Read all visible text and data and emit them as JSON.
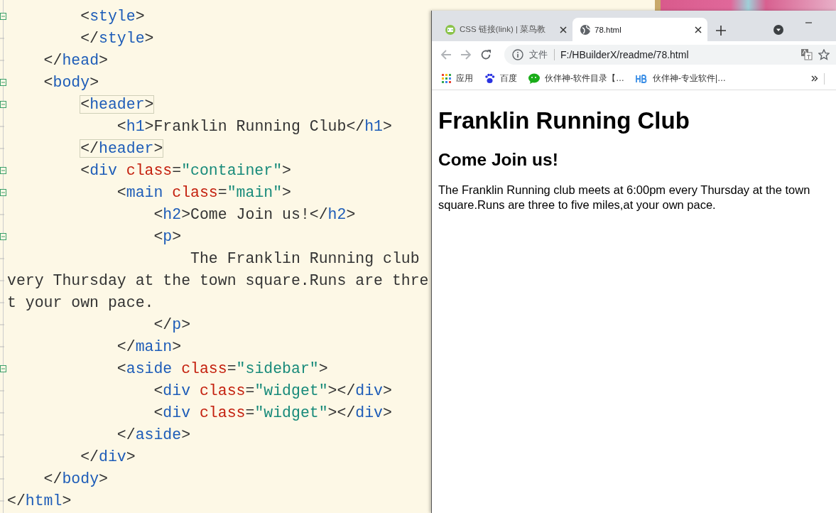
{
  "editor": {
    "lines": [
      {
        "fold": true,
        "boxed": false,
        "tokens": [
          {
            "kind": "punct",
            "text": "        <"
          },
          {
            "kind": "tag",
            "text": "style"
          },
          {
            "kind": "punct",
            "text": ">"
          }
        ]
      },
      {
        "fold": false,
        "boxed": false,
        "tokens": [
          {
            "kind": "punct",
            "text": "        </"
          },
          {
            "kind": "tag",
            "text": "style"
          },
          {
            "kind": "punct",
            "text": ">"
          }
        ]
      },
      {
        "fold": false,
        "boxed": false,
        "tokens": [
          {
            "kind": "punct",
            "text": "    </"
          },
          {
            "kind": "tag",
            "text": "head"
          },
          {
            "kind": "punct",
            "text": ">"
          }
        ]
      },
      {
        "fold": true,
        "boxed": false,
        "tokens": [
          {
            "kind": "punct",
            "text": "    <"
          },
          {
            "kind": "tag",
            "text": "body"
          },
          {
            "kind": "punct",
            "text": ">"
          }
        ]
      },
      {
        "fold": true,
        "boxed": true,
        "tokens": [
          {
            "kind": "punct",
            "text": "        <"
          },
          {
            "kind": "tag",
            "text": "header"
          },
          {
            "kind": "punct",
            "text": ">"
          }
        ]
      },
      {
        "fold": false,
        "boxed": false,
        "tokens": [
          {
            "kind": "punct",
            "text": "            <"
          },
          {
            "kind": "tag",
            "text": "h1"
          },
          {
            "kind": "punct",
            "text": ">"
          },
          {
            "kind": "text",
            "text": "Franklin Running Club"
          },
          {
            "kind": "punct",
            "text": "</"
          },
          {
            "kind": "tag",
            "text": "h1"
          },
          {
            "kind": "punct",
            "text": ">"
          }
        ]
      },
      {
        "fold": false,
        "boxed": true,
        "tokens": [
          {
            "kind": "punct",
            "text": "        </"
          },
          {
            "kind": "tag",
            "text": "header"
          },
          {
            "kind": "punct",
            "text": ">"
          }
        ]
      },
      {
        "fold": true,
        "boxed": false,
        "tokens": [
          {
            "kind": "punct",
            "text": "        <"
          },
          {
            "kind": "tag",
            "text": "div "
          },
          {
            "kind": "attr",
            "text": "class"
          },
          {
            "kind": "punct",
            "text": "="
          },
          {
            "kind": "string",
            "text": "\"container\""
          },
          {
            "kind": "punct",
            "text": ">"
          }
        ]
      },
      {
        "fold": true,
        "boxed": false,
        "tokens": [
          {
            "kind": "punct",
            "text": "            <"
          },
          {
            "kind": "tag",
            "text": "main "
          },
          {
            "kind": "attr",
            "text": "class"
          },
          {
            "kind": "punct",
            "text": "="
          },
          {
            "kind": "string",
            "text": "\"main\""
          },
          {
            "kind": "punct",
            "text": ">"
          }
        ]
      },
      {
        "fold": false,
        "boxed": false,
        "tokens": [
          {
            "kind": "punct",
            "text": "                <"
          },
          {
            "kind": "tag",
            "text": "h2"
          },
          {
            "kind": "punct",
            "text": ">"
          },
          {
            "kind": "text",
            "text": "Come Join us!"
          },
          {
            "kind": "punct",
            "text": "</"
          },
          {
            "kind": "tag",
            "text": "h2"
          },
          {
            "kind": "punct",
            "text": ">"
          }
        ]
      },
      {
        "fold": true,
        "boxed": false,
        "tokens": [
          {
            "kind": "punct",
            "text": "                <"
          },
          {
            "kind": "tag",
            "text": "p"
          },
          {
            "kind": "punct",
            "text": ">"
          }
        ]
      },
      {
        "fold": false,
        "boxed": false,
        "tokens": [
          {
            "kind": "text",
            "text": "                    The Franklin Running club"
          }
        ]
      },
      {
        "fold": false,
        "boxed": false,
        "tokens": [
          {
            "kind": "text",
            "text": "very Thursday at the town square.Runs are thre"
          }
        ]
      },
      {
        "fold": false,
        "boxed": false,
        "tokens": [
          {
            "kind": "text",
            "text": "t your own pace."
          }
        ]
      },
      {
        "fold": false,
        "boxed": false,
        "tokens": [
          {
            "kind": "punct",
            "text": "                </"
          },
          {
            "kind": "tag",
            "text": "p"
          },
          {
            "kind": "punct",
            "text": ">"
          }
        ]
      },
      {
        "fold": false,
        "boxed": false,
        "tokens": [
          {
            "kind": "punct",
            "text": "            </"
          },
          {
            "kind": "tag",
            "text": "main"
          },
          {
            "kind": "punct",
            "text": ">"
          }
        ]
      },
      {
        "fold": true,
        "boxed": false,
        "tokens": [
          {
            "kind": "punct",
            "text": "            <"
          },
          {
            "kind": "tag",
            "text": "aside "
          },
          {
            "kind": "attr",
            "text": "class"
          },
          {
            "kind": "punct",
            "text": "="
          },
          {
            "kind": "string",
            "text": "\"sidebar\""
          },
          {
            "kind": "punct",
            "text": ">"
          }
        ]
      },
      {
        "fold": false,
        "boxed": false,
        "tokens": [
          {
            "kind": "punct",
            "text": "                <"
          },
          {
            "kind": "tag",
            "text": "div "
          },
          {
            "kind": "attr",
            "text": "class"
          },
          {
            "kind": "punct",
            "text": "="
          },
          {
            "kind": "string",
            "text": "\"widget\""
          },
          {
            "kind": "punct",
            "text": "></"
          },
          {
            "kind": "tag",
            "text": "div"
          },
          {
            "kind": "punct",
            "text": ">"
          }
        ]
      },
      {
        "fold": false,
        "boxed": false,
        "tokens": [
          {
            "kind": "punct",
            "text": "                <"
          },
          {
            "kind": "tag",
            "text": "div "
          },
          {
            "kind": "attr",
            "text": "class"
          },
          {
            "kind": "punct",
            "text": "="
          },
          {
            "kind": "string",
            "text": "\"widget\""
          },
          {
            "kind": "punct",
            "text": "></"
          },
          {
            "kind": "tag",
            "text": "div"
          },
          {
            "kind": "punct",
            "text": ">"
          }
        ]
      },
      {
        "fold": false,
        "boxed": false,
        "tokens": [
          {
            "kind": "punct",
            "text": "            </"
          },
          {
            "kind": "tag",
            "text": "aside"
          },
          {
            "kind": "punct",
            "text": ">"
          }
        ]
      },
      {
        "fold": false,
        "boxed": false,
        "tokens": [
          {
            "kind": "punct",
            "text": "        </"
          },
          {
            "kind": "tag",
            "text": "div"
          },
          {
            "kind": "punct",
            "text": ">"
          }
        ]
      },
      {
        "fold": false,
        "boxed": false,
        "tokens": [
          {
            "kind": "punct",
            "text": "    </"
          },
          {
            "kind": "tag",
            "text": "body"
          },
          {
            "kind": "punct",
            "text": ">"
          }
        ]
      },
      {
        "fold": false,
        "boxed": false,
        "tokens": [
          {
            "kind": "punct",
            "text": "</"
          },
          {
            "kind": "tag",
            "text": "html"
          },
          {
            "kind": "punct",
            "text": ">"
          }
        ]
      }
    ]
  },
  "browser": {
    "tabs": [
      {
        "kind": "code",
        "title": "CSS 链接(link) | 菜鸟教",
        "selected": false
      },
      {
        "kind": "globe",
        "title": "78.html",
        "selected": true
      }
    ],
    "toolbar": {
      "back_disabled": true,
      "forward_disabled": true,
      "security_label": "文件",
      "url": "F:/HBuilderX/readme/78.html"
    },
    "bookmarks": [
      {
        "kind": "apps",
        "label": "应用"
      },
      {
        "kind": "paw",
        "label": "百度"
      },
      {
        "kind": "chat",
        "label": "伙伴神-软件目录【…"
      },
      {
        "kind": "hb",
        "label": "伙伴神-专业软件|…"
      }
    ],
    "page": {
      "heading": "Franklin Running Club",
      "subheading": "Come Join us!",
      "paragraph": "The Franklin Running club meets at 6:00pm every Thursday at the town square.Runs are three to five miles,at your own pace."
    }
  }
}
